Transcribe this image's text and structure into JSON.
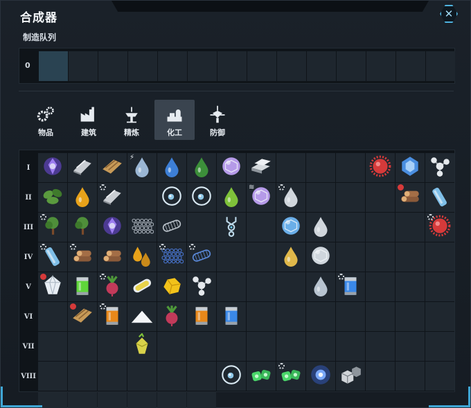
{
  "window": {
    "title": "合成器",
    "close_label": "✕"
  },
  "queue": {
    "label": "制造队列",
    "index": "0",
    "slot_count": 14,
    "active_slot": 0
  },
  "tabs": [
    {
      "label": "物品",
      "icon": "gears-icon",
      "selected": false
    },
    {
      "label": "建筑",
      "icon": "factory-icon",
      "selected": false
    },
    {
      "label": "精炼",
      "icon": "refinery-icon",
      "selected": false
    },
    {
      "label": "化工",
      "icon": "chemical-plant-icon",
      "selected": true
    },
    {
      "label": "防御",
      "icon": "turret-icon",
      "selected": false
    }
  ],
  "row_labels": [
    "I",
    "II",
    "III",
    "IV",
    "V",
    "VI",
    "VII",
    "VIII"
  ],
  "grid": {
    "columns": 14,
    "cells": [
      [
        {
          "icon": "purple-crystal-icon",
          "color": "#6a48d6"
        },
        {
          "icon": "steel-plates-icon",
          "color": "#c9cdd2"
        },
        {
          "icon": "wood-planks-icon",
          "color": "#c79a58"
        },
        {
          "icon": "water-drop-icon",
          "color": "#9ab6d4",
          "badge": "bolt"
        },
        {
          "icon": "water-drop-icon",
          "color": "#3d7fd6"
        },
        {
          "icon": "green-drop-icon",
          "color": "#3c8f3a"
        },
        {
          "icon": "crystal-ball-icon",
          "color": "#b59ae8"
        },
        {
          "icon": "metal-bars-icon",
          "color": "#d5dade"
        },
        null,
        null,
        null,
        {
          "icon": "red-spiky-ball-icon",
          "color": "#d63a3a"
        },
        {
          "icon": "blue-crystal-cell-icon",
          "color": "#4a8ee0"
        },
        {
          "icon": "molecule-icon",
          "color": "#e4e8ec"
        },
        {
          "icon": "plant-leaves-icon",
          "color": "#5a9a3e"
        }
      ],
      [
        {
          "icon": "oil-drop-icon",
          "color": "#e8a21a"
        },
        {
          "icon": "steel-plates-icon",
          "color": "#c9cdd2",
          "badge": "gear"
        },
        null,
        {
          "icon": "ring-atom-icon",
          "color": "#8fc8e8"
        },
        {
          "icon": "ring-atom-icon",
          "color": "#8fc8e8"
        },
        {
          "icon": "green-drop-icon",
          "color": "#7fc23a"
        },
        {
          "icon": "crystal-ball-icon",
          "color": "#b59ae8",
          "badge": "stack"
        },
        {
          "icon": "water-drop-icon",
          "color": "#d0d6dc",
          "badge": "gear"
        },
        null,
        null,
        null,
        {
          "icon": "log-pile-icon",
          "color": "#8a5a3a",
          "badge": "red"
        },
        {
          "icon": "glass-tube-icon",
          "color": "#7fbfe8"
        },
        {
          "icon": "tree-sapling-icon",
          "color": "#4f8f3a",
          "badge": "gear"
        },
        {
          "icon": "tree-sapling-icon",
          "color": "#4f8f3a"
        }
      ],
      [
        {
          "icon": "purple-crystal-icon",
          "color": "#6a48d6"
        },
        {
          "icon": "graphene-sheet-icon",
          "color": "#aab2bb"
        },
        {
          "icon": "carbon-tube-icon",
          "color": "#b8c0c8"
        },
        null,
        {
          "icon": "particle-trap-icon",
          "color": "#bcd8e8"
        },
        null,
        {
          "icon": "blue-orb-icon",
          "color": "#6aaee8"
        },
        {
          "icon": "water-drop-icon",
          "color": "#d0d6dc"
        },
        null,
        null,
        null,
        {
          "icon": "red-spiky-ball-icon",
          "color": "#d63a3a",
          "badge": "gear"
        },
        {
          "icon": "glass-tube-icon",
          "color": "#7fbfe8",
          "badge": "gear"
        },
        {
          "icon": "log-pile-icon",
          "color": "#8a5a3a",
          "badge": "gear"
        },
        {
          "icon": "log-pile-icon",
          "color": "#8a5a3a"
        }
      ],
      [
        {
          "icon": "fire-ice-drops-icon",
          "color": "#e8a21a"
        },
        {
          "icon": "graphene-sheet-icon",
          "color": "#4a78d6",
          "badge": "gear"
        },
        {
          "icon": "carbon-tube-icon",
          "color": "#5a88d8",
          "badge": "gear"
        },
        null,
        null,
        {
          "icon": "oil-drop-icon",
          "color": "#e0b84a"
        },
        {
          "icon": "fullerene-ball-icon",
          "color": "#cfd6dd"
        },
        null,
        null,
        null,
        null,
        {
          "icon": "diamond-crystal-icon",
          "color": "#e8eef4",
          "badge": "red"
        },
        {
          "icon": "green-canister-icon",
          "color": "#5fd63a"
        },
        {
          "icon": "beet-root-icon",
          "color": "#c23a5a",
          "badge": "gear"
        },
        {
          "icon": "bio-capsule-icon",
          "color": "#e8d24a"
        }
      ],
      [
        {
          "icon": "gold-ore-icon",
          "color": "#f2c21a"
        },
        {
          "icon": "molecule-icon",
          "color": "#e4e8ec"
        },
        null,
        null,
        null,
        {
          "icon": "water-drop-icon",
          "color": "#b8c4d0"
        },
        {
          "icon": "blue-canister-icon",
          "color": "#3a88e8",
          "badge": "gear"
        },
        null,
        null,
        null,
        null,
        {
          "icon": "wood-planks-icon",
          "color": "#c79a58",
          "badge": "red"
        },
        {
          "icon": "orange-canister-icon",
          "color": "#e8881a",
          "badge": "gear"
        },
        {
          "icon": "salt-pile-icon",
          "color": "#f4f6f8"
        },
        {
          "icon": "beet-root-icon",
          "color": "#c23a5a"
        }
      ],
      [
        {
          "icon": "orange-canister-icon",
          "color": "#e8881a"
        },
        {
          "icon": "blue-canister-icon",
          "color": "#3a88e8"
        },
        null,
        null,
        null,
        null,
        null,
        null,
        null,
        null,
        null,
        null,
        {
          "icon": "yellow-gem-icon",
          "color": "#d8d24a"
        },
        null,
        null
      ],
      [
        null,
        null,
        null,
        null,
        null,
        null,
        null,
        null,
        null,
        null,
        null,
        null,
        null,
        null
      ],
      [
        {
          "icon": "ring-atom-icon",
          "color": "#8fc8e8"
        },
        {
          "icon": "green-cells-icon",
          "color": "#4ad66a"
        },
        {
          "icon": "green-cells-icon",
          "color": "#4ad66a",
          "badge": "gear"
        },
        {
          "icon": "blue-plasma-icon",
          "color": "#3a6ae8"
        },
        {
          "icon": "grey-cubes-icon",
          "color": "#d0d4d8"
        },
        null,
        null,
        null,
        null,
        null,
        null,
        null,
        null,
        null
      ]
    ]
  }
}
